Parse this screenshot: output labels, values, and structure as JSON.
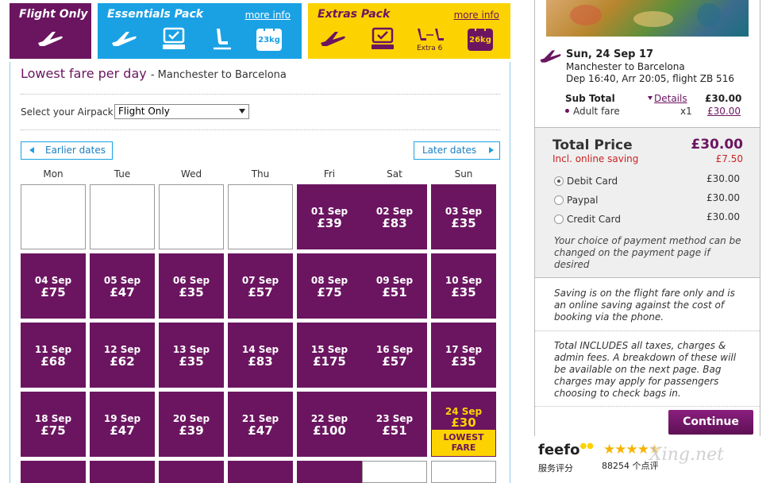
{
  "airpacks": {
    "flight_only": {
      "title": "Flight Only"
    },
    "essentials": {
      "title": "Essentials Pack",
      "more_info": "more info",
      "bag": "23kg"
    },
    "extras": {
      "title": "Extras Pack",
      "more_info": "more info",
      "bag": "26kg",
      "extra_label": "Extra 6"
    }
  },
  "fare_calendar": {
    "title": "Lowest fare per day",
    "route": "- Manchester to Barcelona",
    "airpack_label": "Select your Airpack",
    "airpack_selected": "Flight Only",
    "earlier": "Earlier dates",
    "later": "Later dates",
    "days": [
      "Mon",
      "Tue",
      "Wed",
      "Thu",
      "Fri",
      "Sat",
      "Sun"
    ],
    "weeks": [
      [
        null,
        null,
        null,
        null,
        {
          "date": "01 Sep",
          "price": "£39"
        },
        {
          "date": "02 Sep",
          "price": "£83"
        },
        {
          "date": "03 Sep",
          "price": "£35"
        }
      ],
      [
        {
          "date": "04 Sep",
          "price": "£75"
        },
        {
          "date": "05 Sep",
          "price": "£47"
        },
        {
          "date": "06 Sep",
          "price": "£35"
        },
        {
          "date": "07 Sep",
          "price": "£57"
        },
        {
          "date": "08 Sep",
          "price": "£75"
        },
        {
          "date": "09 Sep",
          "price": "£51"
        },
        {
          "date": "10 Sep",
          "price": "£35"
        }
      ],
      [
        {
          "date": "11 Sep",
          "price": "£68"
        },
        {
          "date": "12 Sep",
          "price": "£62"
        },
        {
          "date": "13 Sep",
          "price": "£35"
        },
        {
          "date": "14 Sep",
          "price": "£83"
        },
        {
          "date": "15 Sep",
          "price": "£175"
        },
        {
          "date": "16 Sep",
          "price": "£57"
        },
        {
          "date": "17 Sep",
          "price": "£35"
        }
      ],
      [
        {
          "date": "18 Sep",
          "price": "£75"
        },
        {
          "date": "19 Sep",
          "price": "£47"
        },
        {
          "date": "20 Sep",
          "price": "£39"
        },
        {
          "date": "21 Sep",
          "price": "£47"
        },
        {
          "date": "22 Sep",
          "price": "£100"
        },
        {
          "date": "23 Sep",
          "price": "£51"
        },
        {
          "date": "24 Sep",
          "price": "£30",
          "selected": true,
          "badge": "LOWEST FARE"
        }
      ]
    ]
  },
  "summary": {
    "flight_date": "Sun, 24 Sep 17",
    "flight_route": "Manchester  to Barcelona",
    "flight_times": "Dep 16:40, Arr 20:05, flight ZB 516",
    "subtotal_label": "Sub Total",
    "details_link": "Details",
    "subtotal_amount": "£30.00",
    "adult_label": "Adult fare",
    "adult_qty": "x1",
    "adult_amount": "£30.00",
    "total_label": "Total Price",
    "total_amount": "£30.00",
    "incl_label": "Incl. online saving",
    "incl_amount": "£7.50",
    "payment": [
      {
        "label": "Debit Card",
        "amount": "£30.00",
        "checked": true
      },
      {
        "label": "Paypal",
        "amount": "£30.00",
        "checked": false
      },
      {
        "label": "Credit Card",
        "amount": "£30.00",
        "checked": false
      }
    ],
    "payment_note": "Your choice of payment method can be changed on the payment page if desired",
    "saving_note": "Saving is on the flight fare only and is an online saving against the cost of booking via the phone.",
    "total_note": "Total INCLUDES all taxes, charges & admin fees. A breakdown of these will be available on the next page. Bag charges may apply for passengers choosing to check bags in.",
    "continue": "Continue"
  },
  "feefo": {
    "brand": "feefo",
    "sub_label": "服务评分",
    "reviews": "88254 个点评",
    "rating": 4.5,
    "watermark": "Xing.net"
  },
  "colors": {
    "brand_purple": "#6b1560",
    "essentials_blue": "#1aa1e4",
    "extras_yellow": "#fcd300"
  }
}
